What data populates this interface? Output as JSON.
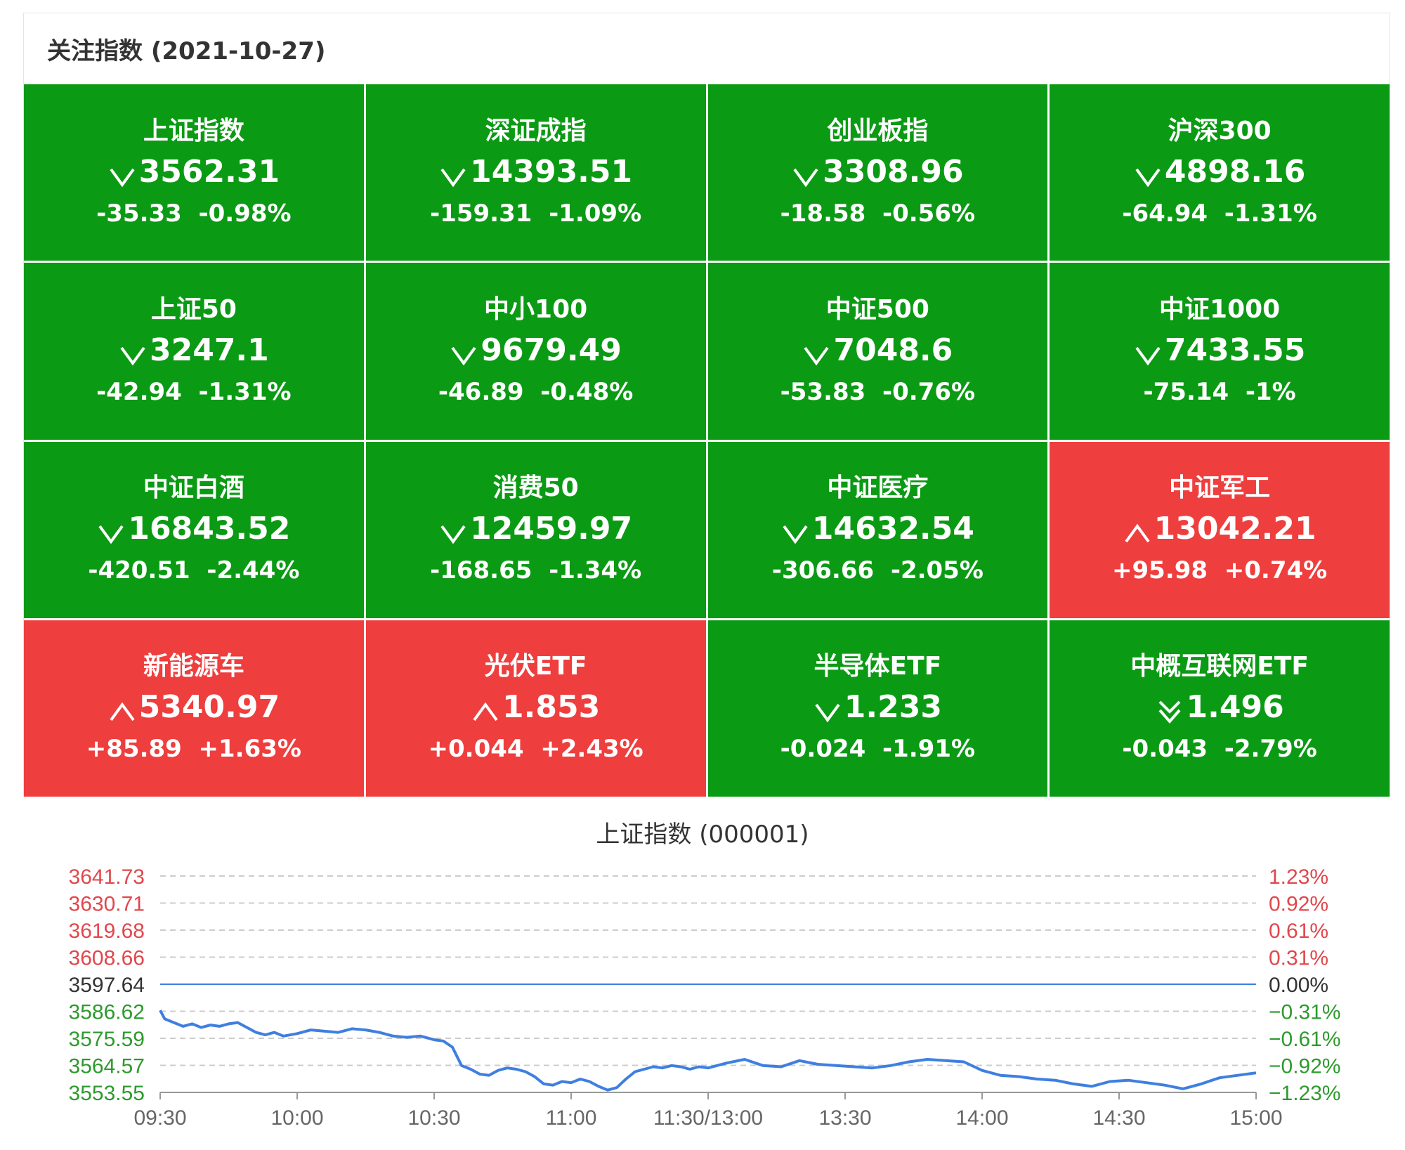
{
  "header": {
    "title": "关注指数 (2021-10-27)"
  },
  "tiles": [
    {
      "name": "上证指数",
      "arrow": "down",
      "price": "3562.31",
      "change": "-35.33",
      "pct": "-0.98%",
      "trend": "down"
    },
    {
      "name": "深证成指",
      "arrow": "down",
      "price": "14393.51",
      "change": "-159.31",
      "pct": "-1.09%",
      "trend": "down"
    },
    {
      "name": "创业板指",
      "arrow": "down",
      "price": "3308.96",
      "change": "-18.58",
      "pct": "-0.56%",
      "trend": "down"
    },
    {
      "name": "沪深300",
      "arrow": "down",
      "price": "4898.16",
      "change": "-64.94",
      "pct": "-1.31%",
      "trend": "down"
    },
    {
      "name": "上证50",
      "arrow": "down",
      "price": "3247.1",
      "change": "-42.94",
      "pct": "-1.31%",
      "trend": "down"
    },
    {
      "name": "中小100",
      "arrow": "down",
      "price": "9679.49",
      "change": "-46.89",
      "pct": "-0.48%",
      "trend": "down"
    },
    {
      "name": "中证500",
      "arrow": "down",
      "price": "7048.6",
      "change": "-53.83",
      "pct": "-0.76%",
      "trend": "down"
    },
    {
      "name": "中证1000",
      "arrow": "down",
      "price": "7433.55",
      "change": "-75.14",
      "pct": "-1%",
      "trend": "down"
    },
    {
      "name": "中证白酒",
      "arrow": "down",
      "price": "16843.52",
      "change": "-420.51",
      "pct": "-2.44%",
      "trend": "down"
    },
    {
      "name": "消费50",
      "arrow": "down",
      "price": "12459.97",
      "change": "-168.65",
      "pct": "-1.34%",
      "trend": "down"
    },
    {
      "name": "中证医疗",
      "arrow": "down",
      "price": "14632.54",
      "change": "-306.66",
      "pct": "-2.05%",
      "trend": "down"
    },
    {
      "name": "中证军工",
      "arrow": "up",
      "price": "13042.21",
      "change": "+95.98",
      "pct": "+0.74%",
      "trend": "up"
    },
    {
      "name": "新能源车",
      "arrow": "up",
      "price": "5340.97",
      "change": "+85.89",
      "pct": "+1.63%",
      "trend": "up"
    },
    {
      "name": "光伏ETF",
      "arrow": "up",
      "price": "1.853",
      "change": "+0.044",
      "pct": "+2.43%",
      "trend": "up"
    },
    {
      "name": "半导体ETF",
      "arrow": "down",
      "price": "1.233",
      "change": "-0.024",
      "pct": "-1.91%",
      "trend": "down"
    },
    {
      "name": "中概互联网ETF",
      "arrow": "double-down",
      "price": "1.496",
      "change": "-0.043",
      "pct": "-2.79%",
      "trend": "down"
    }
  ],
  "colors": {
    "up": "#ee3e3e",
    "down": "#0b9a14",
    "line": "#3f7fe0",
    "axis_up": "#e0474c",
    "axis_down": "#2d9a2d",
    "axis_neutral": "#333333"
  },
  "chart_data": {
    "type": "line",
    "title": "上证指数 (000001)",
    "base": 3597.64,
    "ylim": [
      3553.55,
      3641.73
    ],
    "y_ticks_left": [
      "3641.73",
      "3630.71",
      "3619.68",
      "3608.66",
      "3597.64",
      "3586.62",
      "3575.59",
      "3564.57",
      "3553.55"
    ],
    "y_ticks_right": [
      "1.23%",
      "0.92%",
      "0.61%",
      "0.31%",
      "0.00%",
      "−0.31%",
      "−0.61%",
      "−0.92%",
      "−1.23%"
    ],
    "x_ticks": [
      "09:30",
      "10:00",
      "10:30",
      "11:00",
      "11:30/13:00",
      "13:30",
      "14:00",
      "14:30",
      "15:00"
    ],
    "x_range_minutes": [
      0,
      240
    ],
    "grid": "dashed horizontal",
    "series": [
      {
        "x": [
          0,
          1,
          3,
          5,
          7,
          9,
          11,
          13,
          15,
          17,
          19,
          21,
          23,
          25,
          27,
          30,
          33,
          36,
          39,
          42,
          45,
          48,
          51,
          54,
          57,
          60,
          62,
          64,
          66,
          68,
          70,
          72,
          74,
          76,
          78,
          80,
          82,
          84,
          86,
          88,
          90,
          92,
          94,
          96,
          98,
          100,
          102,
          104,
          106,
          108,
          110,
          112,
          114,
          116,
          118,
          120,
          124,
          128,
          132,
          136,
          140,
          144,
          148,
          152,
          156,
          160,
          164,
          168,
          172,
          176,
          180,
          184,
          188,
          192,
          196,
          200,
          204,
          208,
          212,
          216,
          220,
          224,
          228,
          232,
          236,
          240
        ],
        "y": [
          3587.0,
          3583.5,
          3582.0,
          3580.5,
          3581.5,
          3580.0,
          3581.0,
          3580.5,
          3581.5,
          3582.0,
          3580.0,
          3578.0,
          3577.0,
          3578.0,
          3576.5,
          3577.5,
          3579.0,
          3578.5,
          3578.0,
          3579.5,
          3579.0,
          3578.0,
          3576.5,
          3576.0,
          3576.5,
          3575.0,
          3574.5,
          3572.0,
          3564.5,
          3563.0,
          3561.0,
          3560.5,
          3562.5,
          3563.5,
          3563.0,
          3562.0,
          3560.0,
          3557.0,
          3556.5,
          3558.0,
          3557.5,
          3559.0,
          3558.0,
          3556.0,
          3554.5,
          3555.5,
          3559.0,
          3562.0,
          3563.0,
          3564.0,
          3563.5,
          3564.5,
          3564.0,
          3563.0,
          3564.0,
          3563.5,
          3565.5,
          3567.0,
          3564.5,
          3564.0,
          3566.5,
          3565.0,
          3564.5,
          3564.0,
          3563.5,
          3564.5,
          3566.0,
          3567.0,
          3566.5,
          3566.0,
          3562.5,
          3560.5,
          3560.0,
          3559.0,
          3558.5,
          3557.0,
          3556.0,
          3558.0,
          3558.5,
          3557.5,
          3556.5,
          3555.0,
          3557.0,
          3559.5,
          3560.5,
          3561.5
        ]
      }
    ]
  }
}
